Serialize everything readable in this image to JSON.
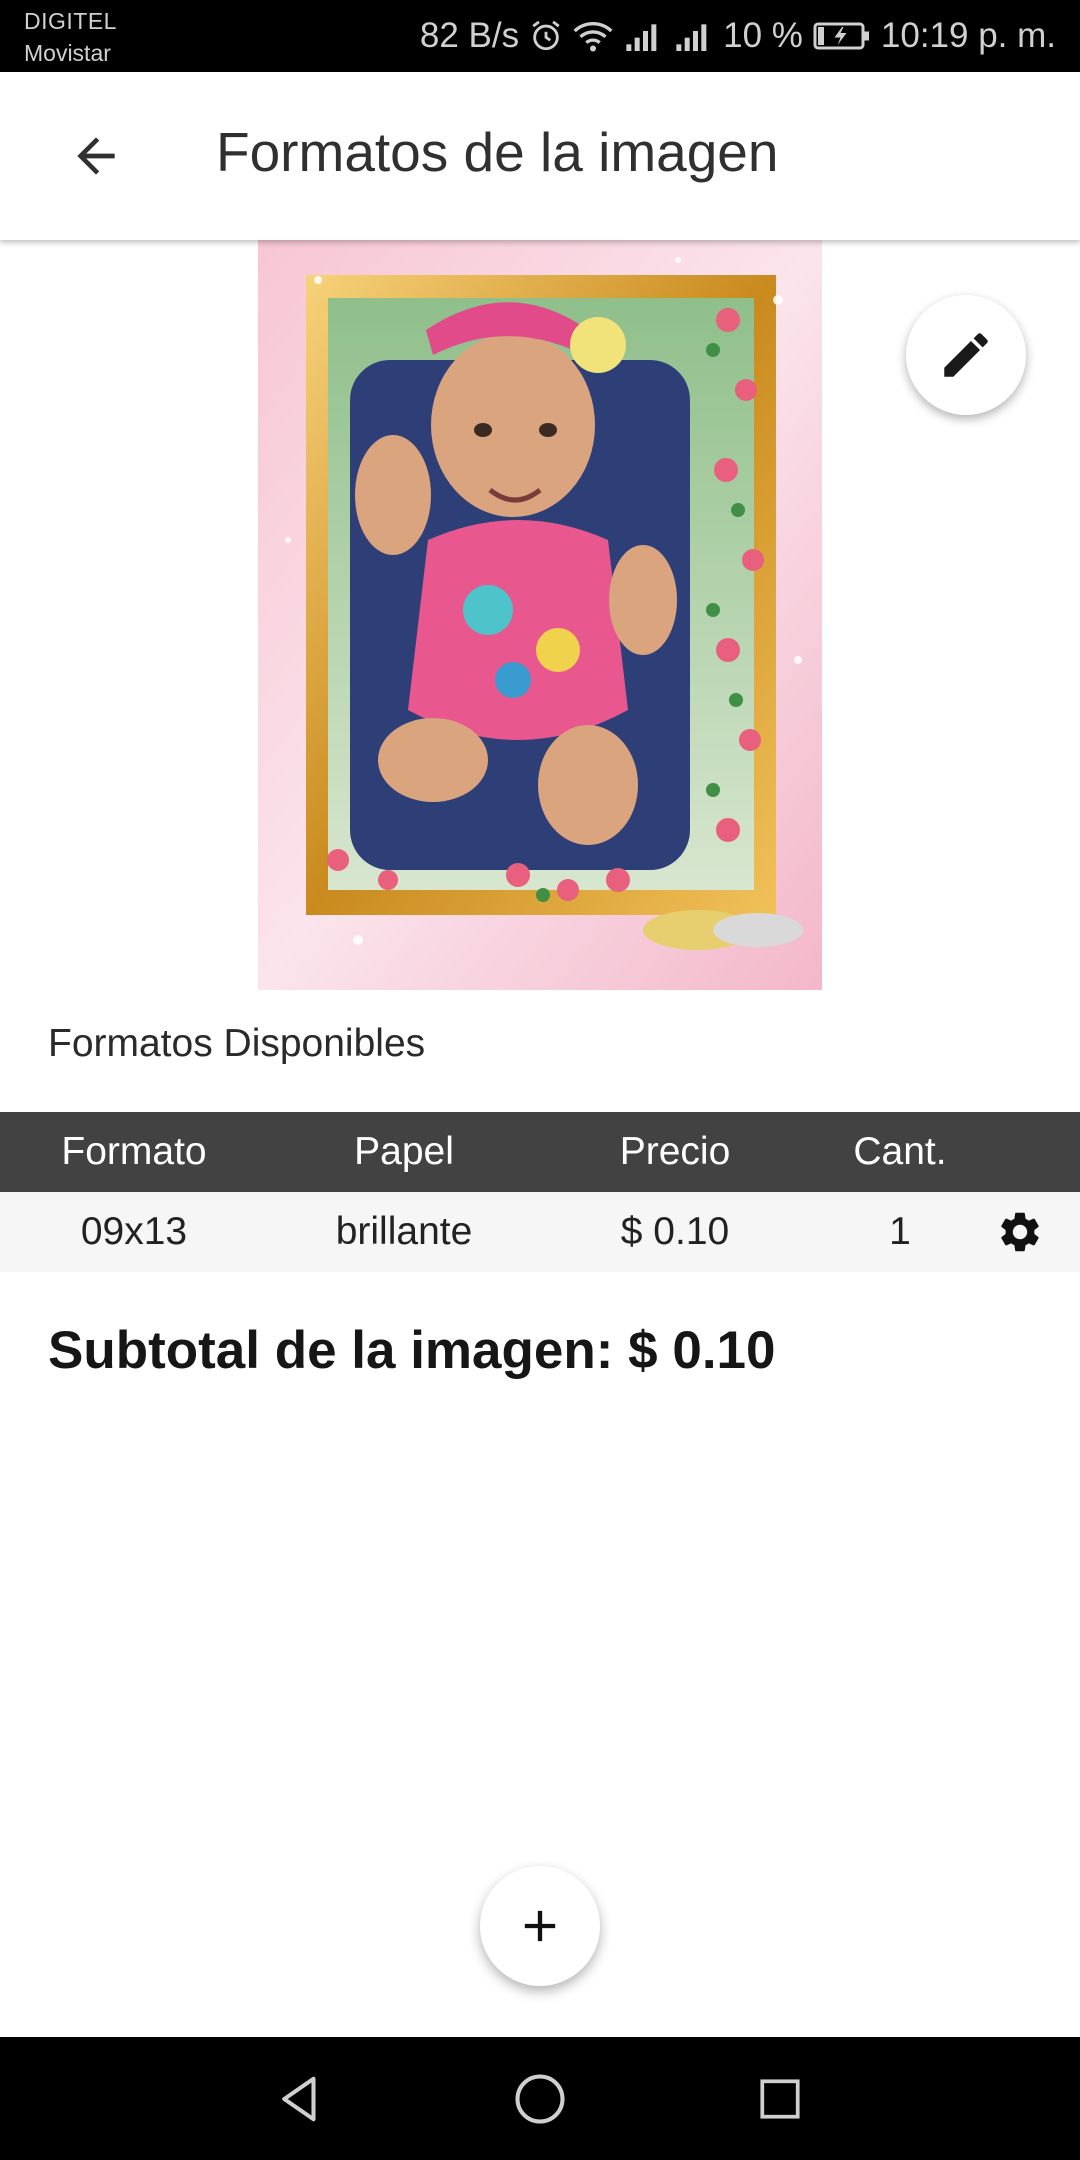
{
  "status_bar": {
    "carrier_1": "DIGITEL",
    "carrier_2": "Movistar",
    "network_speed": "82 B/s",
    "battery": "10 %",
    "time": "10:19 p. m.",
    "icons": [
      "alarm-icon",
      "wifi-icon",
      "signal-icon",
      "signal-icon",
      "battery-charging-icon"
    ]
  },
  "app_bar": {
    "back_icon": "arrow-back-icon",
    "title": "Formatos de la imagen"
  },
  "photo": {
    "description_icon": "framed-photo",
    "edit_icon": "pencil-icon"
  },
  "formats": {
    "section_title": "Formatos Disponibles",
    "columns": [
      "Formato",
      "Papel",
      "Precio",
      "Cant."
    ],
    "rows": [
      {
        "formato": "09x13",
        "papel": "brillante",
        "precio": "$ 0.10",
        "cantidad": "1",
        "action_icon": "gear-icon"
      }
    ]
  },
  "subtotal": {
    "label": "Subtotal de la imagen:",
    "value": "$ 0.10"
  },
  "add_button_icon": "plus-icon",
  "nav_bar": {
    "icons": [
      "nav-back-icon",
      "nav-home-icon",
      "nav-recents-icon"
    ]
  },
  "colors": {
    "table_header": "#424242",
    "table_row": "#f6f6f6",
    "status_bar": "#000000",
    "nav_bar": "#000000"
  }
}
